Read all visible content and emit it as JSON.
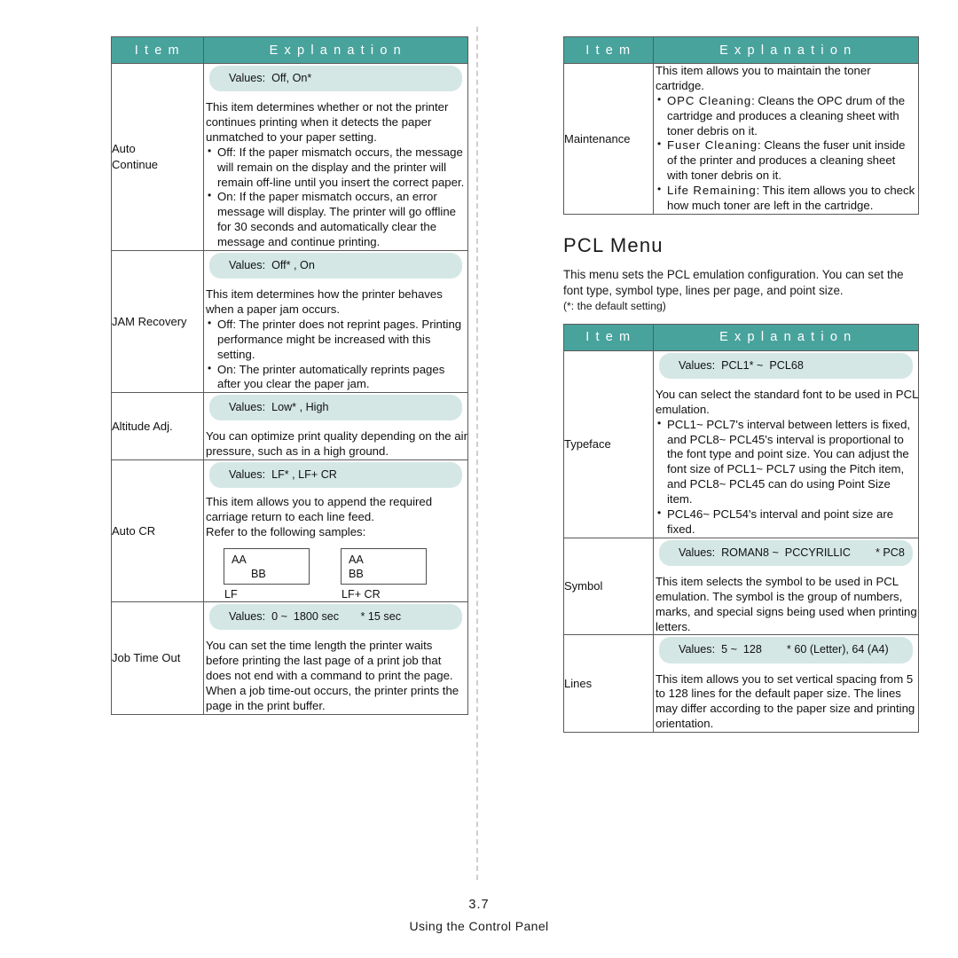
{
  "page": {
    "number": "3.7",
    "footer_text": "Using the Control Panel"
  },
  "colors": {
    "header_teal": "#49a39d",
    "values_pill": "#d4e7e5",
    "border": "#5a5a5a",
    "gutter_dash": "#cfcfcf"
  },
  "table_headers": {
    "item": "I t e m",
    "explanation": "E x p l a n a t i o n"
  },
  "left_table": {
    "rows": [
      {
        "item": "Auto\nContinue",
        "values": "Values:  Off, On*",
        "intro": "This item determines whether or not the printer continues printing when it detects the paper unmatched to your paper setting.",
        "bullets": [
          "Off: If the paper mismatch occurs, the message will remain on the display and the printer will remain off-line until you insert the correct paper.",
          "On: If the paper mismatch occurs, an error message will display. The printer will go offline for 30 seconds and automatically clear the message and continue printing."
        ]
      },
      {
        "item": "JAM Recovery",
        "values": "Values:  Off* , On",
        "intro": "This item determines how the printer behaves when a paper jam occurs.",
        "bullets": [
          "Off: The printer does not reprint pages. Printing performance might be increased with this setting.",
          "On: The printer automatically reprints pages after you clear the paper jam."
        ]
      },
      {
        "item": "Altitude Adj.",
        "values": "Values:  Low* , High",
        "intro": "You can optimize print quality depending on the air pressure, such as in a high ground.",
        "bullets": []
      },
      {
        "item": "Auto CR",
        "values": "Values:  LF* , LF+ CR",
        "intro": "This item allows you to append the required carriage return to each line feed.\nRefer to the following samples:",
        "bullets": [],
        "samples": [
          {
            "line1": "AA",
            "line2": "BB",
            "indent2": true,
            "caption": "LF"
          },
          {
            "line1": "AA",
            "line2": "BB",
            "indent2": false,
            "caption": "LF+ CR"
          }
        ]
      },
      {
        "item": "Job Time Out",
        "values": "Values:  0 ~  1800 sec       * 15 sec",
        "intro": "You can set the time length the printer waits before printing the last page of a print job that does not end with a command to print the page.\nWhen a job time-out occurs, the printer prints the page in the print buffer.",
        "bullets": []
      }
    ]
  },
  "right_table_top": {
    "rows": [
      {
        "item": "Maintenance",
        "intro": "This item allows you to maintain the toner cartridge.",
        "bullets": [
          {
            "label": "OPC Cleaning",
            "text": ": Cleans the OPC drum of the cartridge and produces a cleaning sheet with toner debris on it."
          },
          {
            "label": "Fuser Cleaning",
            "text": ": Cleans the fuser unit inside of the printer and produces a cleaning sheet with toner debris on it."
          },
          {
            "label": "Life Remaining",
            "text": ": This item allows you to check how much toner are left in the cartridge."
          }
        ]
      }
    ]
  },
  "pcl_section": {
    "heading": "PCL Menu",
    "body": "This menu sets the PCL emulation configuration. You can set the font type, symbol type, lines per page, and point size.",
    "note": "(*: the default setting)"
  },
  "pcl_table": {
    "rows": [
      {
        "item": "Typeface",
        "values": "Values:  PCL1* ~  PCL68",
        "intro": "You can select the standard font to be used in PCL emulation.",
        "bullets": [
          "PCL1~ PCL7's interval between letters is fixed, and PCL8~ PCL45's interval is proportional to the font type and point size. You can adjust the font size of PCL1~ PCL7 using the Pitch item, and PCL8~ PCL45 can do using Point Size item.",
          "PCL46~ PCL54's interval and point size are fixed."
        ]
      },
      {
        "item": "Symbol",
        "values": "Values:  ROMAN8 ~  PCCYRILLIC        * PC8",
        "intro": "This item selects the symbol to be used in PCL emulation. The symbol is the group of numbers, marks, and special signs being used when printing letters.",
        "bullets": []
      },
      {
        "item": "Lines",
        "values": "Values:  5 ~  128        * 60 (Letter), 64 (A4)",
        "intro": "This item allows you to set vertical spacing from 5 to 128 lines for the default paper size. The lines may differ according to the paper size and printing orientation.",
        "bullets": []
      }
    ]
  }
}
